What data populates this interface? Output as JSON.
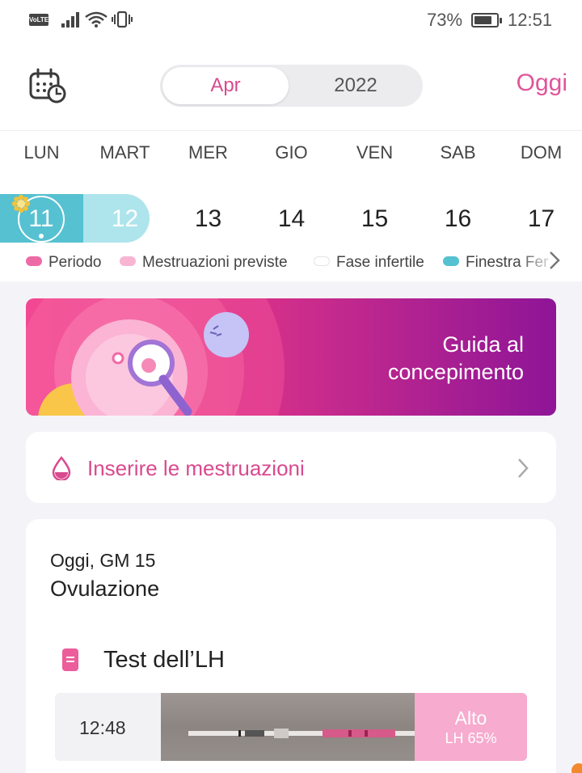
{
  "status_bar": {
    "volte": "VoLTE",
    "battery_percent": "73%",
    "time": "12:51"
  },
  "header": {
    "calendar_icon": "calendar-clock-icon",
    "month": "Apr",
    "year": "2022",
    "today_label": "Oggi",
    "accent": "#e0559a"
  },
  "week": {
    "weekdays": [
      "LUN",
      "MART",
      "MER",
      "GIO",
      "VEN",
      "SAB",
      "DOM"
    ],
    "dates": [
      "11",
      "12",
      "13",
      "14",
      "15",
      "16",
      "17"
    ],
    "selected": "11"
  },
  "legend": [
    {
      "label": "Periodo",
      "color": "#ee6aa7"
    },
    {
      "label": "Mestruazioni previste",
      "color": "#f7b5d3"
    },
    {
      "label": "Fase infertile",
      "color": "#ffffff"
    },
    {
      "label": "Finestra Fer",
      "color": "#56c1d1"
    }
  ],
  "banner": {
    "line1": "Guida al",
    "line2": "concepimento"
  },
  "insert_period": {
    "label": "Inserire le mestruazioni",
    "icon": "drop-icon"
  },
  "today_card": {
    "day": "Oggi, GM 15",
    "phase": "Ovulazione",
    "test_title": "Test dell’LH",
    "entry": {
      "time": "12:48",
      "level": "Alto",
      "lh": "LH 65%"
    }
  }
}
